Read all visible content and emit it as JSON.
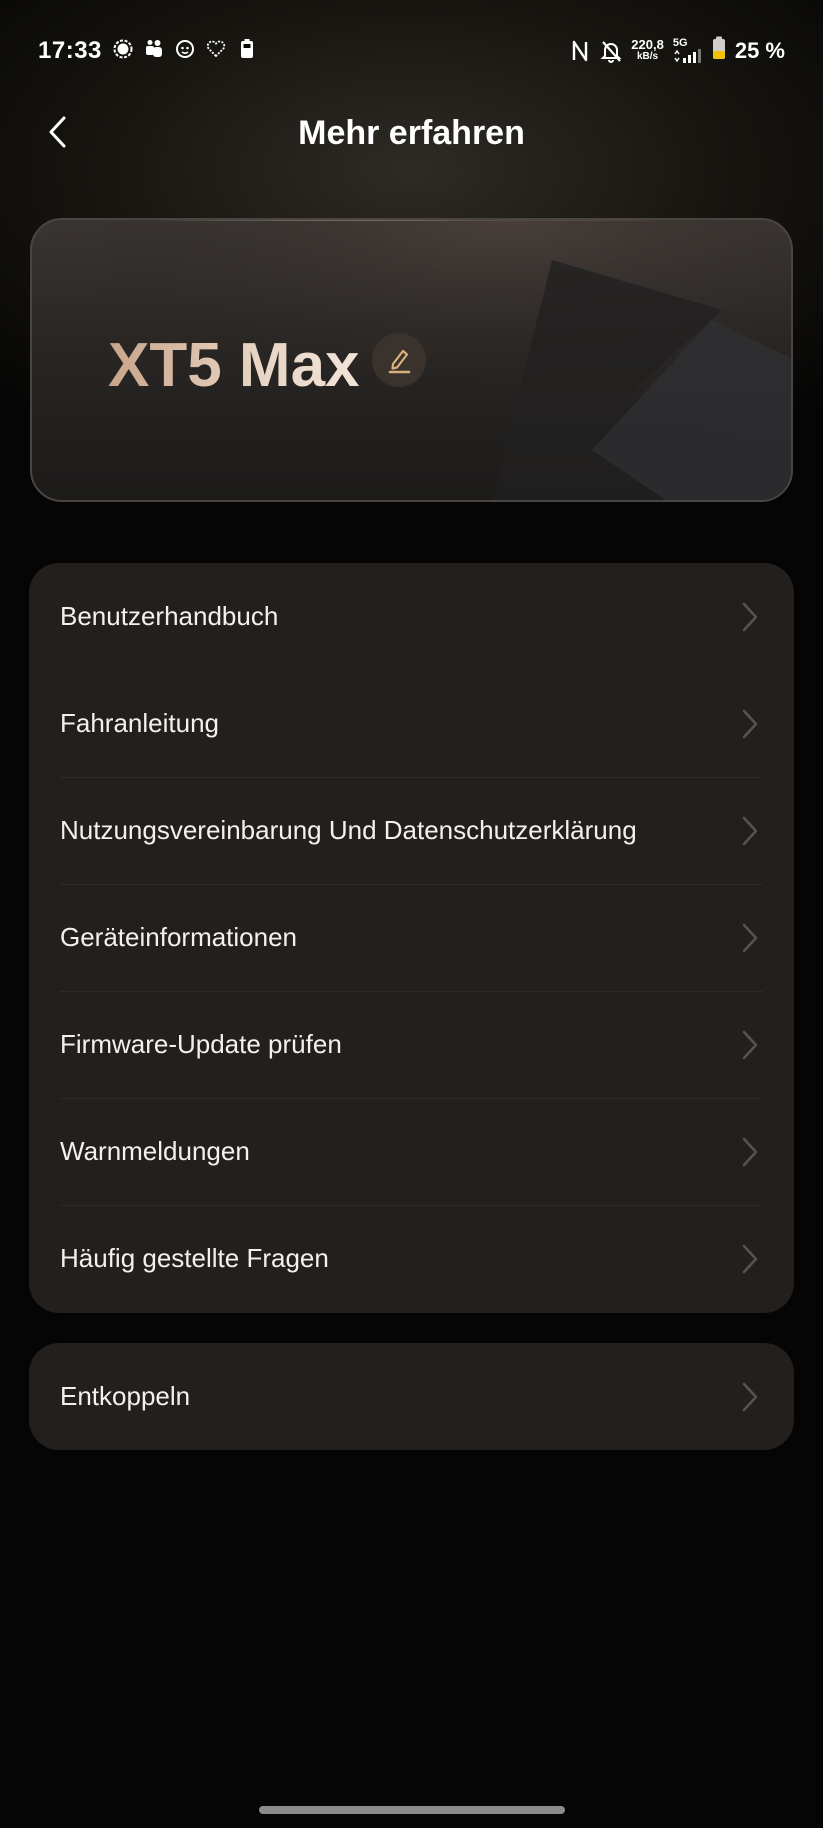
{
  "status_bar": {
    "time": "17:33",
    "left_icons": [
      "signal-messenger-icon",
      "teams-icon",
      "lion-app-icon",
      "heart-rate-icon",
      "battery-saver-icon"
    ],
    "right_icons": [
      "nfc-icon",
      "notifications-muted-icon"
    ],
    "speed_value": "220,8",
    "speed_unit": "kB/s",
    "network_type": "5G",
    "battery_percent": "25 %"
  },
  "header": {
    "title": "Mehr erfahren",
    "back_icon": "chevron-left-icon"
  },
  "device_card": {
    "name": "XT5 Max",
    "edit_icon": "pencil-icon"
  },
  "menu": {
    "items": [
      {
        "label": "Benutzerhandbuch"
      },
      {
        "label": "Fahranleitung"
      },
      {
        "label": "Nutzungsvereinbarung Und Datenschutzerklärung"
      },
      {
        "label": "Geräteinformationen"
      },
      {
        "label": "Firmware-Update prüfen"
      },
      {
        "label": "Warnmeldungen"
      },
      {
        "label": "Häufig gestellte Fragen"
      }
    ],
    "unpair": {
      "label": "Entkoppeln"
    }
  },
  "colors": {
    "background": "#050505",
    "card": "#221f1d",
    "accent_gold": "#d8b07a",
    "text": "#f3f0ed",
    "chevron": "#56524e"
  }
}
